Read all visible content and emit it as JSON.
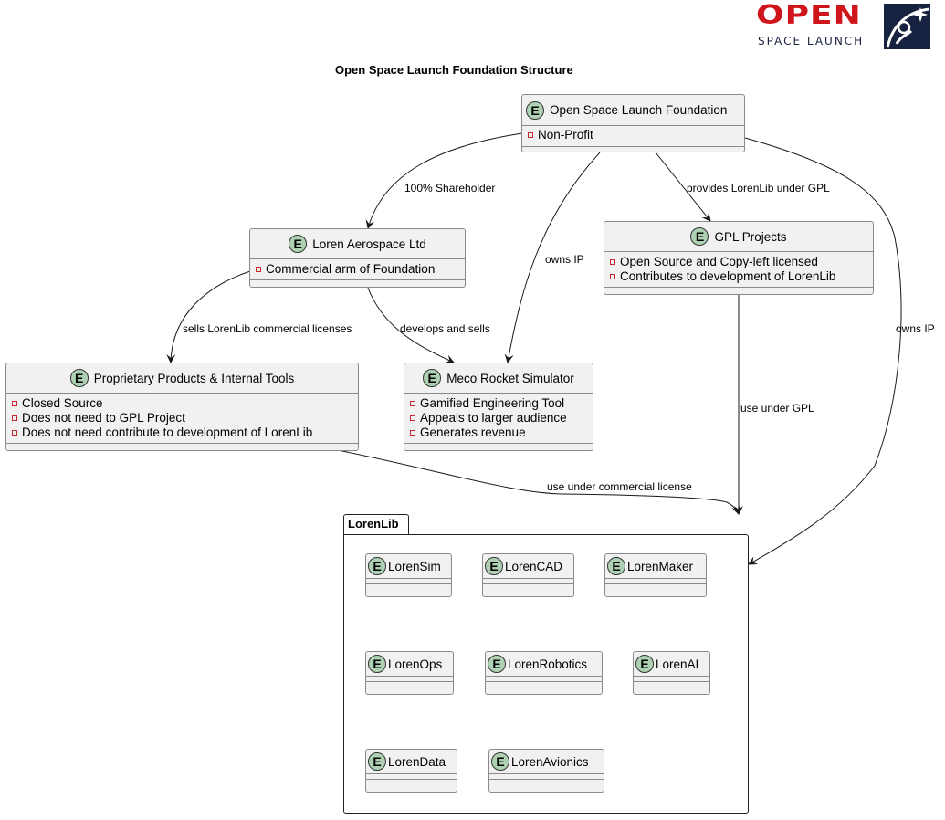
{
  "title": "Open Space Launch Foundation Structure",
  "logo": {
    "word": "OPEN",
    "subtitle": "SPACE LAUNCH",
    "icon": "astronaut-star-badge-icon",
    "colors": {
      "red": "#d0141b",
      "navy": "#16223f"
    }
  },
  "entity_badge": "E",
  "entities": {
    "foundation": {
      "name": "Open Space Launch Foundation",
      "attributes": [
        "Non-Profit"
      ]
    },
    "loren_aerospace": {
      "name": "Loren Aerospace Ltd",
      "attributes": [
        "Commercial arm of Foundation"
      ]
    },
    "gpl_projects": {
      "name": "GPL Projects",
      "attributes": [
        "Open Source and Copy-left licensed",
        "Contributes to development of LorenLib"
      ]
    },
    "proprietary": {
      "name": "Proprietary Products & Internal Tools",
      "attributes": [
        "Closed Source",
        "Does not need to GPL Project",
        "Does not need contribute to development of LorenLib"
      ]
    },
    "meco": {
      "name": "Meco Rocket Simulator",
      "attributes": [
        "Gamified Engineering Tool",
        "Appeals to larger audience",
        "Generates revenue"
      ]
    }
  },
  "package": {
    "name": "LorenLib",
    "members": [
      "LorenSim",
      "LorenCAD",
      "LorenMaker",
      "LorenOps",
      "LorenRobotics",
      "LorenAI",
      "LorenData",
      "LorenAvionics"
    ]
  },
  "relations": [
    {
      "from": "Open Space Launch Foundation",
      "to": "Loren Aerospace Ltd",
      "label": "100% Shareholder"
    },
    {
      "from": "Open Space Launch Foundation",
      "to": "Meco Rocket Simulator",
      "label": "owns IP"
    },
    {
      "from": "Open Space Launch Foundation",
      "to": "GPL Projects",
      "label": "provides LorenLib under GPL"
    },
    {
      "from": "Open Space Launch Foundation",
      "to": "LorenLib",
      "label": "owns IP"
    },
    {
      "from": "Loren Aerospace Ltd",
      "to": "Proprietary Products & Internal Tools",
      "label": "sells LorenLib commercial licenses"
    },
    {
      "from": "Loren Aerospace Ltd",
      "to": "Meco Rocket Simulator",
      "label": "develops and sells"
    },
    {
      "from": "GPL Projects",
      "to": "LorenLib",
      "label": "use under GPL"
    },
    {
      "from": "Proprietary Products & Internal Tools",
      "to": "LorenLib",
      "label": "use under commercial license"
    }
  ]
}
